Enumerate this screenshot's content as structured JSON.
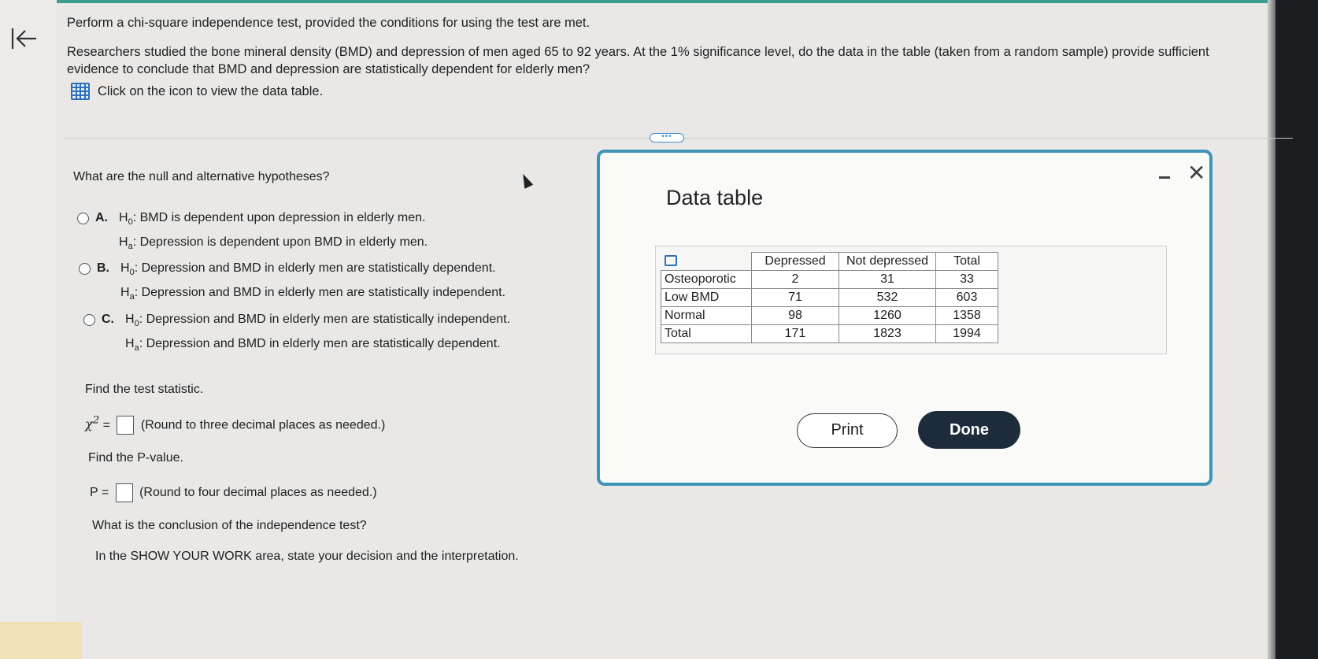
{
  "question": {
    "intro": "Perform a chi-square independence test, provided the conditions for using the test are met.",
    "body": "Researchers studied the bone mineral density (BMD) and depression of men aged 65 to 92 years. At the 1% significance level, do the data in the table (taken from a random sample) provide sufficient evidence to conclude that BMD and depression are statistically dependent for elderly men?",
    "icon_link": "Click on the icon to view the data table."
  },
  "hypotheses": {
    "prompt": "What are the null and alternative hypotheses?",
    "options": [
      {
        "letter": "A.",
        "h0": ": BMD is dependent upon depression in elderly men.",
        "ha": ": Depression is dependent upon BMD in elderly men."
      },
      {
        "letter": "B.",
        "h0": ": Depression and BMD in elderly men are statistically dependent.",
        "ha": ": Depression and BMD in elderly men are statistically independent."
      },
      {
        "letter": "C.",
        "h0": ": Depression and BMD in elderly men are statistically independent.",
        "ha": ": Depression and BMD in elderly men are statistically dependent."
      }
    ]
  },
  "test_statistic": {
    "prompt": "Find the test statistic.",
    "equals": "=",
    "hint": "(Round to three decimal places as needed.)"
  },
  "p_value": {
    "prompt": "Find the P-value.",
    "label": "P =",
    "hint": "(Round to four decimal places as needed.)"
  },
  "conclusion": {
    "prompt": "What is the conclusion of the independence test?",
    "instruction": "In the SHOW YOUR WORK area, state your decision and the interpretation."
  },
  "dialog": {
    "title": "Data table",
    "minimize": "-",
    "close": "✕",
    "columns": [
      "Depressed",
      "Not depressed",
      "Total"
    ],
    "rows": [
      {
        "label": "Osteoporotic",
        "values": [
          "2",
          "31",
          "33"
        ]
      },
      {
        "label": "Low BMD",
        "values": [
          "71",
          "532",
          "603"
        ]
      },
      {
        "label": "Normal",
        "values": [
          "98",
          "1260",
          "1358"
        ]
      },
      {
        "label": "Total",
        "values": [
          "171",
          "1823",
          "1994"
        ]
      }
    ],
    "print_label": "Print",
    "done_label": "Done"
  },
  "colors": {
    "accent": "#3e94b6",
    "done_bg": "#1d2b3b",
    "icon_blue": "#2f6fb8"
  }
}
